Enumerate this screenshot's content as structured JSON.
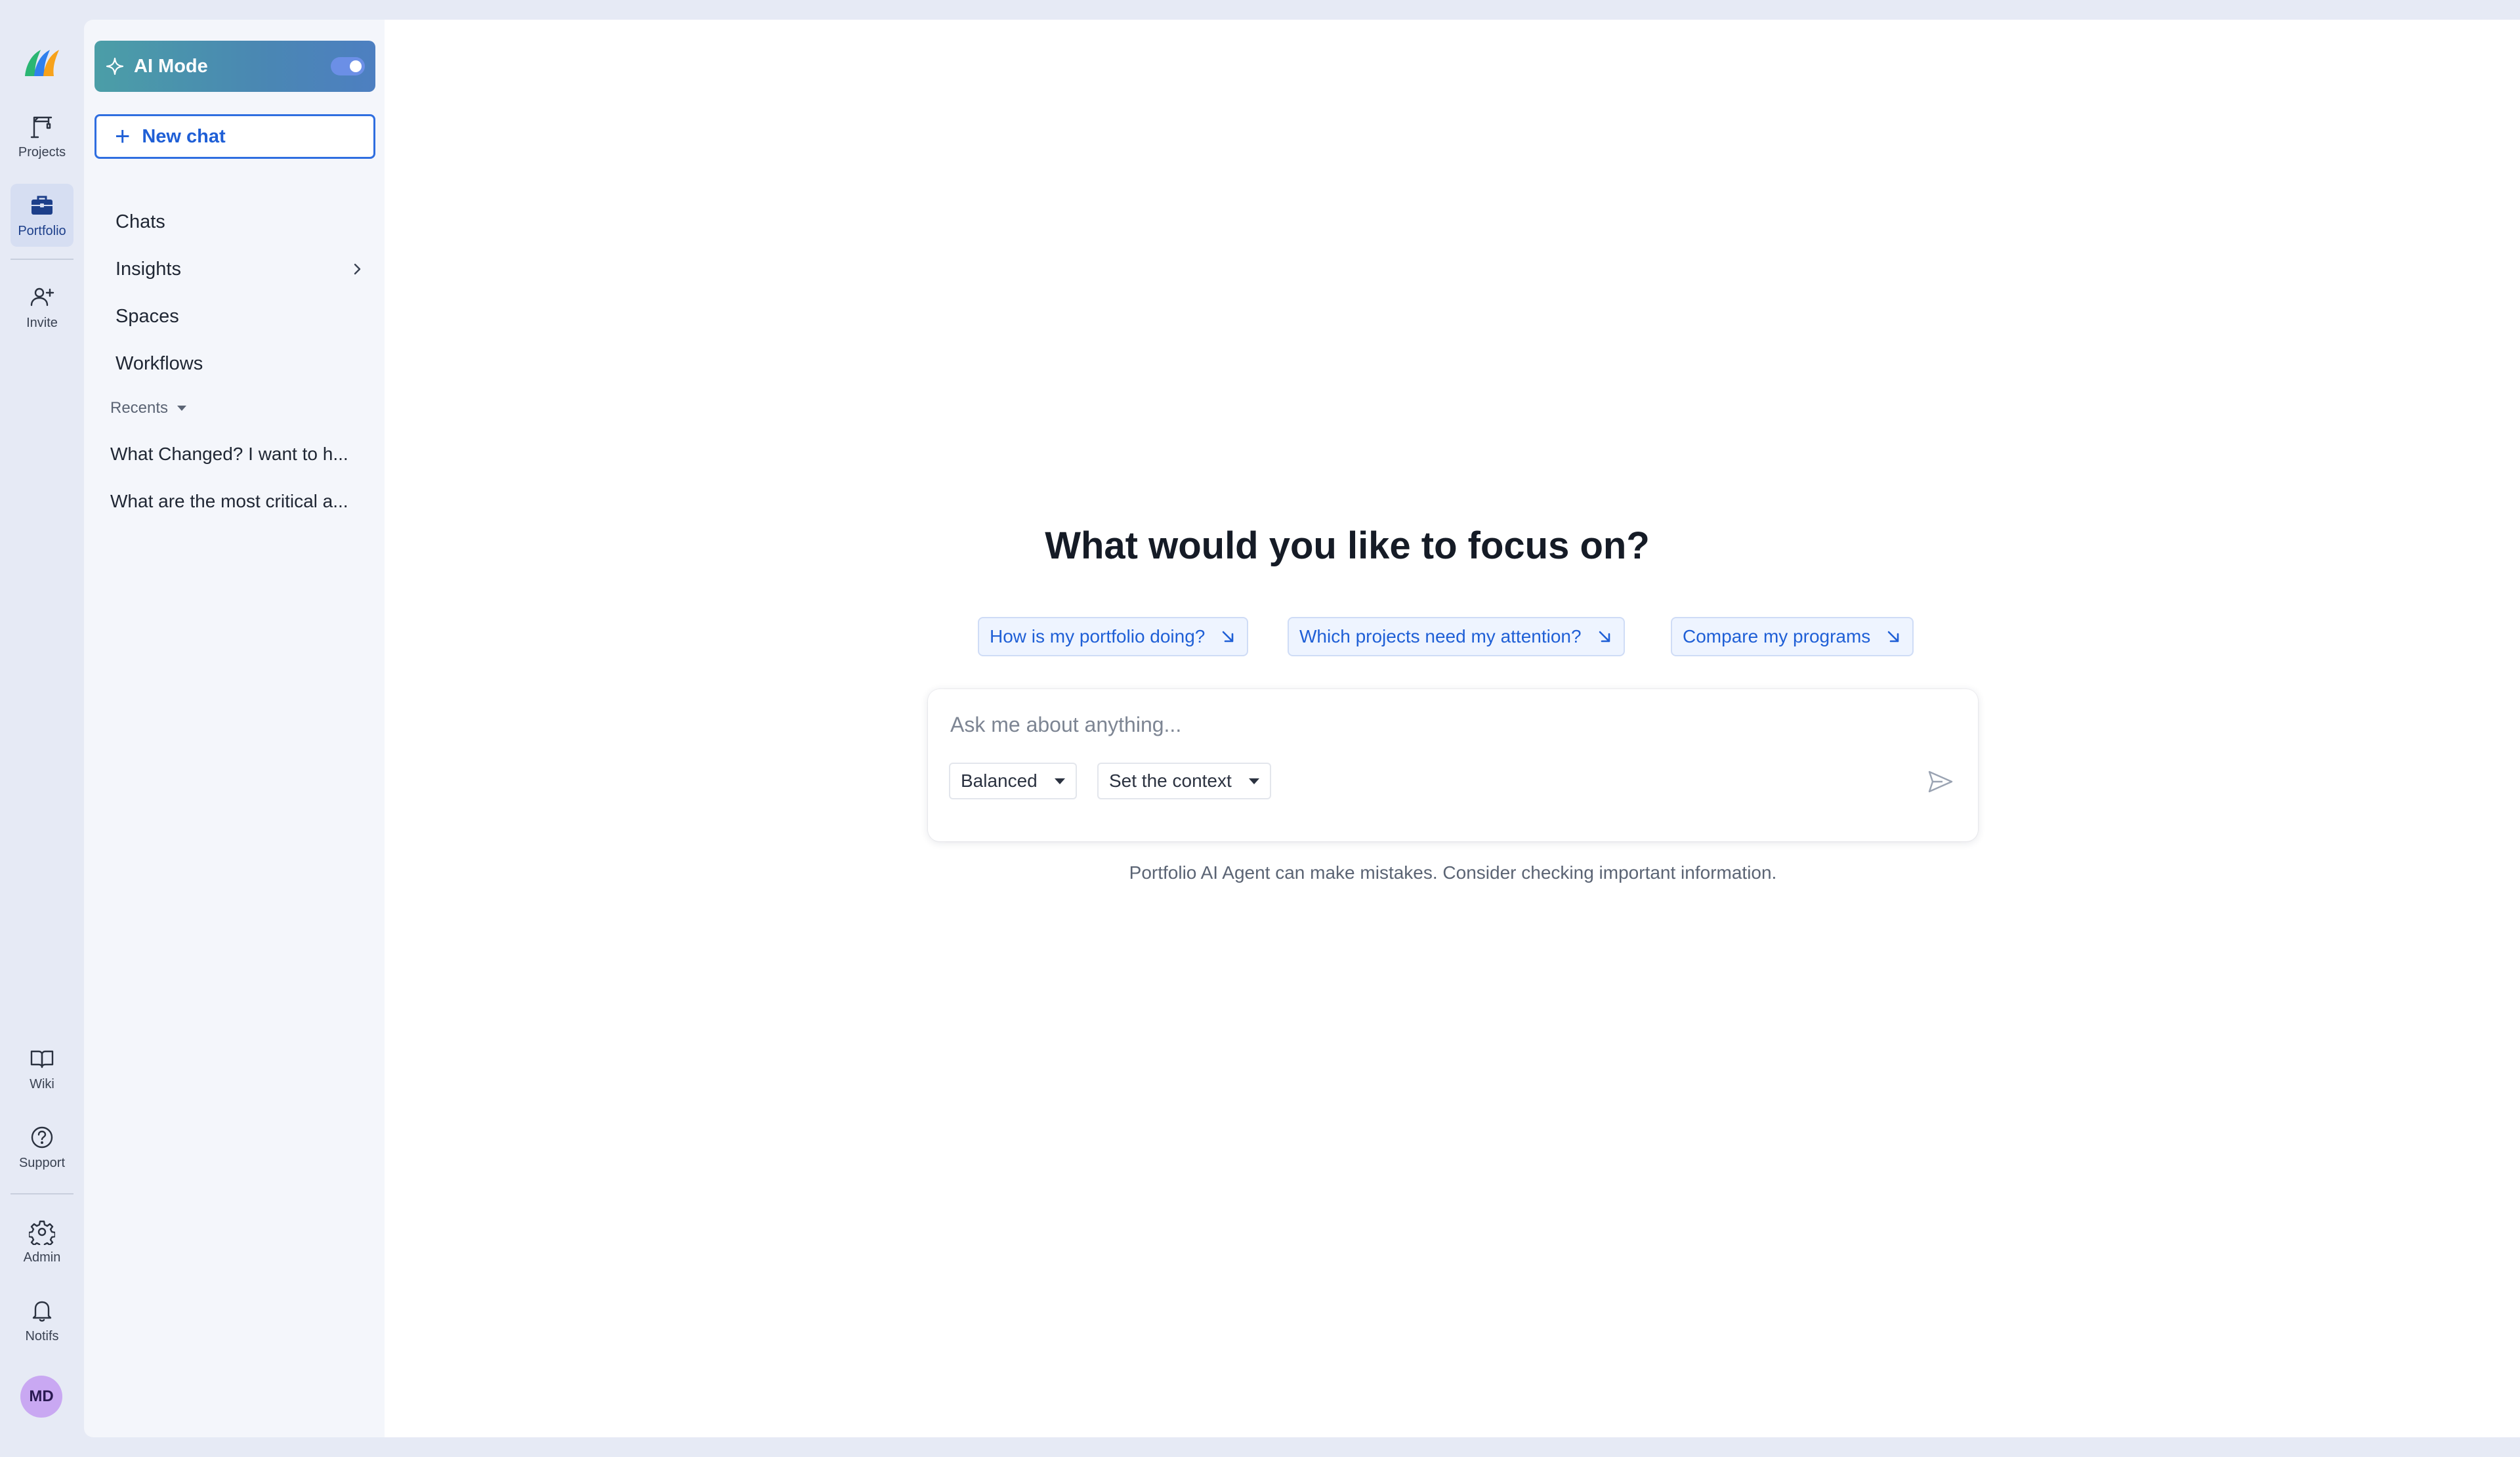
{
  "rail": {
    "items": [
      {
        "label": "Projects",
        "icon": "crane-icon"
      },
      {
        "label": "Portfolio",
        "icon": "briefcase-icon",
        "active": true
      },
      {
        "label": "Invite",
        "icon": "user-plus-icon"
      },
      {
        "label": "Wiki",
        "icon": "book-icon"
      },
      {
        "label": "Support",
        "icon": "help-circle-icon"
      },
      {
        "label": "Admin",
        "icon": "gear-icon"
      },
      {
        "label": "Notifs",
        "icon": "bell-icon"
      }
    ],
    "avatar_initials": "MD"
  },
  "sidebar": {
    "ai_mode_label": "AI Mode",
    "ai_mode_enabled": true,
    "new_chat_label": "New chat",
    "nav": [
      {
        "label": "Chats"
      },
      {
        "label": "Insights",
        "has_submenu": true
      },
      {
        "label": "Spaces"
      },
      {
        "label": "Workflows"
      }
    ],
    "recents_label": "Recents",
    "recents": [
      "What Changed? I want to h...",
      "What are the most critical a..."
    ]
  },
  "main": {
    "headline": "What would you like to focus on?",
    "suggestions": [
      "How is my portfolio doing?",
      "Which projects need my attention?",
      "Compare my programs"
    ],
    "composer": {
      "placeholder": "Ask me about anything...",
      "mode_value": "Balanced",
      "context_value": "Set the context"
    },
    "disclaimer": "Portfolio AI Agent can make mistakes. Consider checking important information."
  },
  "colors": {
    "accent": "#1f5fd6",
    "rail_bg": "#e6eaf5",
    "sidebar_bg": "#f4f6fb",
    "ai_gradient_start": "#4b9ea7",
    "ai_gradient_end": "#4d7fc1",
    "avatar": "#c9a8f2"
  }
}
